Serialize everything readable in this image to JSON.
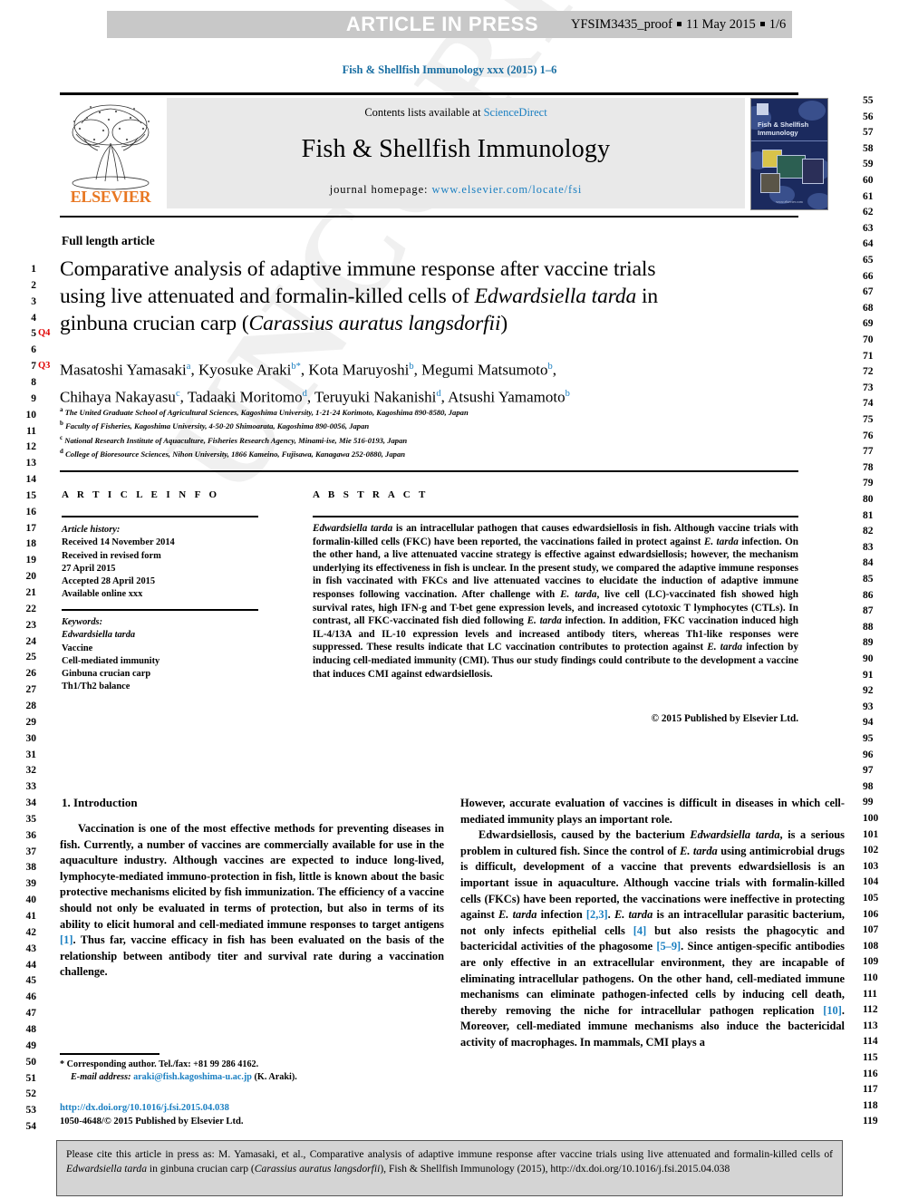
{
  "banner": {
    "title": "ARTICLE IN PRESS",
    "proof_id": "YFSIM3435_proof",
    "proof_date": "11 May 2015",
    "proof_page": "1/6"
  },
  "journal_header": {
    "running_head": "Fish & Shellfish Immunology xxx (2015) 1–6",
    "contents_label": "Contents lists available at",
    "contents_link": "ScienceDirect",
    "journal_name": "Fish & Shellfish Immunology",
    "homepage_label": "journal homepage:",
    "homepage_url": "www.elsevier.com/locate/fsi",
    "publisher_logo_text": "ELSEVIER",
    "cover_title": "Fish & Shellfish Immunology"
  },
  "article": {
    "type": "Full length article",
    "title_line1": "Comparative analysis of adaptive immune response after vaccine trials",
    "title_line2_a": "using live attenuated and formalin-killed cells of ",
    "title_line2_italic": "Edwardsiella tarda",
    "title_line2_b": " in",
    "title_line3_a": "ginbuna crucian carp (",
    "title_line3_italic": "Carassius auratus langsdorfii",
    "title_line3_b": ")",
    "authors": [
      {
        "name": "Masatoshi Yamasaki",
        "sup": "a",
        "sep": ", "
      },
      {
        "name": "Kyosuke Araki",
        "sup": "b",
        "star": "*",
        "sep": ", "
      },
      {
        "name": "Kota Maruyoshi",
        "sup": "b",
        "sep": ", "
      },
      {
        "name": "Megumi Matsumoto",
        "sup": "b",
        "sep": ","
      },
      {
        "name": "Chihaya Nakayasu",
        "sup": "c",
        "sep": ", "
      },
      {
        "name": "Tadaaki Moritomo",
        "sup": "d",
        "sep": ", "
      },
      {
        "name": "Teruyuki Nakanishi",
        "sup": "d",
        "sep": ", "
      },
      {
        "name": "Atsushi Yamamoto",
        "sup": "b",
        "sep": ""
      }
    ],
    "affiliations": [
      {
        "mark": "a",
        "text": "The United Graduate School of Agricultural Sciences, Kagoshima University, 1-21-24 Korimoto, Kagoshima 890-8580, Japan"
      },
      {
        "mark": "b",
        "text": "Faculty of Fisheries, Kagoshima University, 4-50-20 Shimoarata, Kagoshima 890-0056, Japan"
      },
      {
        "mark": "c",
        "text": "National Research Institute of Aquaculture, Fisheries Research Agency, Minami-ise, Mie 516-0193, Japan"
      },
      {
        "mark": "d",
        "text": "College of Bioresource Sciences, Nihon University, 1866 Kameino, Fujisawa, Kanagawa 252-0880, Japan"
      }
    ]
  },
  "article_info": {
    "heading": "A R T I C L E   I N F O",
    "history_label": "Article history:",
    "history": [
      "Received 14 November 2014",
      "Received in revised form",
      "27 April 2015",
      "Accepted 28 April 2015",
      "Available online xxx"
    ],
    "keywords_label": "Keywords:",
    "keywords": [
      "Edwardsiella tarda",
      "Vaccine",
      "Cell-mediated immunity",
      "Ginbuna crucian carp",
      "Th1/Th2 balance"
    ]
  },
  "abstract": {
    "heading": "A B S T R A C T",
    "p1_italic": "Edwardsiella tarda",
    "p1_rest": " is an intracellular pathogen that causes edwardsiellosis in fish. Although vaccine trials with formalin-killed cells (FKC) have been reported, the vaccinations failed in protect against E. tarda infection. On the other hand, a live attenuated vaccine strategy is effective against edwardsiellosis; however, the mechanism underlying its effectiveness in fish is unclear. In the present study, we compared the adaptive immune responses in fish vaccinated with FKCs and live attenuated vaccines to elucidate the induction of adaptive immune responses following vaccination. After challenge with E. tarda, live cell (LC)-vaccinated fish showed high survival rates, high IFN-g and T-bet gene expression levels, and increased cytotoxic T lymphocytes (CTLs). In contrast, all FKC-vaccinated fish died following E. tarda infection. In addition, FKC vaccination induced high IL-4/13A and IL-10 expression levels and increased antibody titers, whereas Th1-like responses were suppressed. These results indicate that LC vaccination contributes to protection against E. tarda infection by inducing cell-mediated immunity (CMI). Thus our study findings could contribute to the development a vaccine that induces CMI against edwardsiellosis.",
    "copyright": "© 2015 Published by Elsevier Ltd."
  },
  "introduction": {
    "heading": "1.  Introduction",
    "left_paragraph": "Vaccination is one of the most effective methods for preventing diseases in fish. Currently, a number of vaccines are commercially available for use in the aquaculture industry. Although vaccines are expected to induce long-lived, lymphocyte-mediated immuno-protection in fish, little is known about the basic protective mechanisms elicited by fish immunization. The efficiency of a vaccine should not only be evaluated in terms of protection, but also in terms of its ability to elicit humoral and cell-mediated immune responses to target antigens [1]. Thus far, vaccine efficacy in fish has been evaluated on the basis of the relationship between antibody titer and survival rate during a vaccination challenge.",
    "right_paragraph_1": "However, accurate evaluation of vaccines is difficult in diseases in which cell-mediated immunity plays an important role.",
    "right_paragraph_2": "Edwardsiellosis, caused by the bacterium Edwardsiella tarda, is a serious problem in cultured fish. Since the control of E. tarda using antimicrobial drugs is difficult, development of a vaccine that prevents edwardsiellosis is an important issue in aquaculture. Although vaccine trials with formalin-killed cells (FKCs) have been reported, the vaccinations were ineffective in protecting against E. tarda infection [2,3]. E. tarda is an intracellular parasitic bacterium, not only infects epithelial cells [4] but also resists the phagocytic and bactericidal activities of the phagosome [5–9]. Since antigen-specific antibodies are only effective in an extracellular environment, they are incapable of eliminating intracellular pathogens. On the other hand, cell-mediated immune mechanisms can eliminate pathogen-infected cells by inducing cell death, thereby removing the niche for intracellular pathogen replication [10]. Moreover, cell-mediated immune mechanisms also induce the bactericidal activity of macrophages. In mammals, CMI plays a"
  },
  "footnote": {
    "corresponding": "* Corresponding author. Tel./fax: +81 99 286 4162.",
    "email_label": "E-mail address:",
    "email": "araki@fish.kagoshima-u.ac.jp",
    "email_suffix": "(K. Araki).",
    "doi": "http://dx.doi.org/10.1016/j.fsi.2015.04.038",
    "issn_line": "1050-4648/© 2015 Published by Elsevier Ltd."
  },
  "citation_box": {
    "prefix": "Please cite this article in press as: M. Yamasaki, et al., Comparative analysis of adaptive immune response after vaccine trials using live attenuated and formalin-killed cells of ",
    "italic1": "Edwardsiella tarda",
    "mid": " in ginbuna crucian carp (",
    "italic2": "Carassius auratus langsdorfii",
    "suffix": "), Fish & Shellfish Immunology (2015), http://dx.doi.org/10.1016/j.fsi.2015.04.038"
  },
  "line_numbers": {
    "left_start": 1,
    "left_end": 54,
    "right_start": 55,
    "right_end": 119,
    "query_tags": [
      {
        "label": "Q4",
        "line": 5
      },
      {
        "label": "Q3",
        "line": 7
      }
    ]
  },
  "watermark": "UNCORRECTED PROOF",
  "colors": {
    "link": "#1a7fc1",
    "running_head": "#1a6fa3",
    "elsevier_orange": "#e87722",
    "banner_bg": "#c8c8c8",
    "masthead_bg": "#e9e9e9",
    "cite_box_bg": "#d4d4d4",
    "query_red": "#e00000"
  }
}
